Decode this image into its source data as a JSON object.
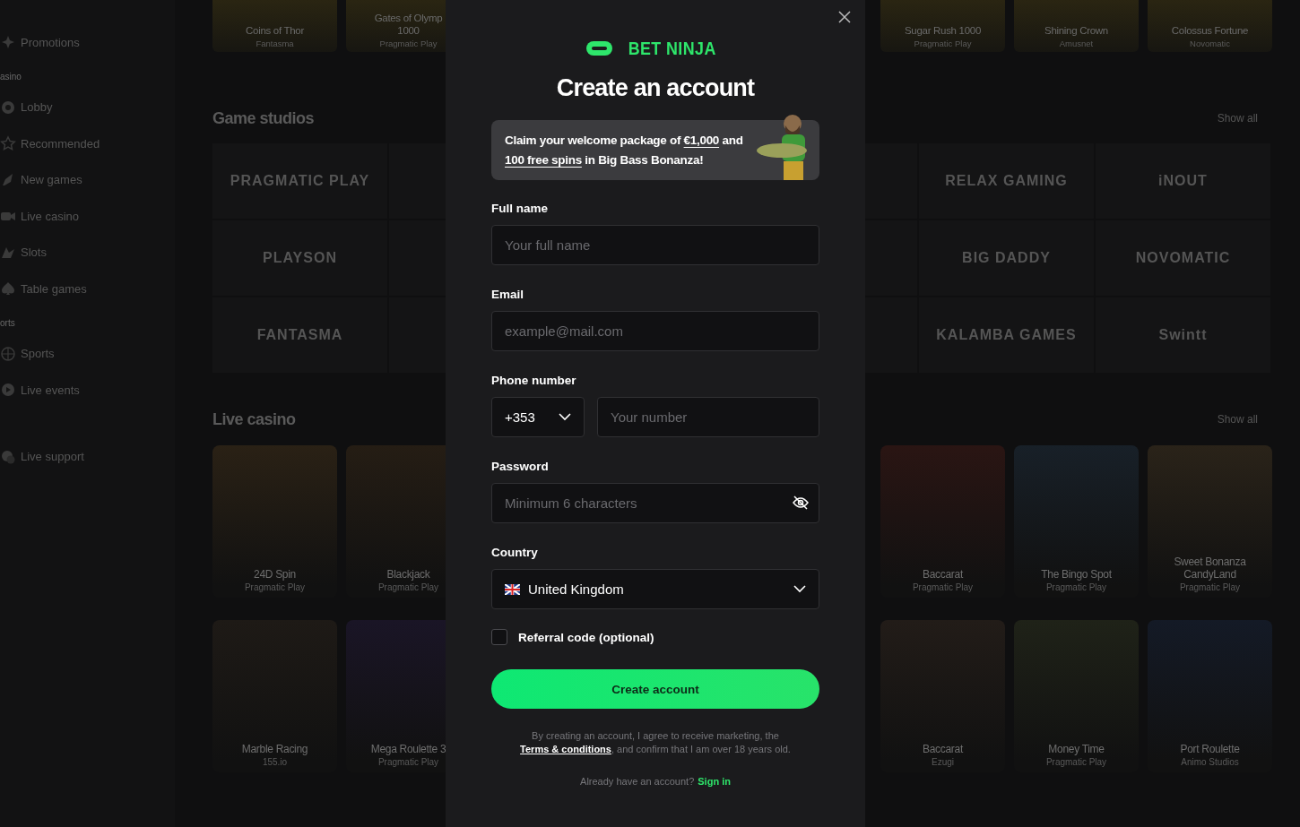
{
  "sidebar": {
    "items": [
      {
        "kind": "item",
        "label": "Promotions"
      },
      {
        "kind": "section",
        "label": "asino"
      },
      {
        "kind": "item",
        "label": "Lobby"
      },
      {
        "kind": "item",
        "label": "Recommended"
      },
      {
        "kind": "item",
        "label": "New games"
      },
      {
        "kind": "item",
        "label": "Live casino"
      },
      {
        "kind": "item",
        "label": "Slots"
      },
      {
        "kind": "item",
        "label": "Table games"
      },
      {
        "kind": "section",
        "label": "orts"
      },
      {
        "kind": "item",
        "label": "Sports"
      },
      {
        "kind": "item",
        "label": "Live events"
      },
      {
        "kind": "gap",
        "label": "Live support"
      }
    ]
  },
  "top_games": {
    "left": [
      {
        "title": "Coins of Thor",
        "provider": "Fantasma"
      },
      {
        "title": "Gates of Olymp\n1000",
        "provider": "Pragmatic Play"
      }
    ],
    "right": [
      {
        "title": "Sugar Rush 1000",
        "provider": "Pragmatic Play"
      },
      {
        "title": "Shining Crown",
        "provider": "Amusnet"
      },
      {
        "title": "Colossus Fortune",
        "provider": "Novomatic"
      }
    ]
  },
  "studios": {
    "title": "Game studios",
    "show_all": "Show all",
    "rows": [
      {
        "left": "PRAGMATIC PLAY",
        "right": [
          "RELAX GAMING",
          "iNOUT"
        ]
      },
      {
        "left": "PLAYSON",
        "right": [
          "BIG DADDY",
          "NOVOMATIC"
        ]
      },
      {
        "left": "FANTASMA",
        "right": [
          "KALAMBA GAMES",
          "Swintt"
        ]
      }
    ]
  },
  "live_casino": {
    "title": "Live casino",
    "show_all": "Show all",
    "rows": [
      {
        "left": [
          {
            "title": "24D Spin",
            "provider": "Pragmatic Play"
          },
          {
            "title": "Blackjack",
            "provider": "Pragmatic Play"
          }
        ],
        "right": [
          {
            "title": "Baccarat",
            "provider": "Pragmatic Play"
          },
          {
            "title": "The Bingo Spot",
            "provider": "Pragmatic Play"
          },
          {
            "title": "Sweet Bonanza CandyLand",
            "provider": "Pragmatic Play"
          }
        ]
      },
      {
        "left": [
          {
            "title": "Marble Racing",
            "provider": "155.io"
          },
          {
            "title": "Mega Roulette 3",
            "provider": "Pragmatic Play"
          }
        ],
        "right": [
          {
            "title": "Baccarat",
            "provider": "Ezugi"
          },
          {
            "title": "Money Time",
            "provider": "Pragmatic Play"
          },
          {
            "title": "Port Roulette",
            "provider": "Animo Studios"
          }
        ]
      }
    ]
  },
  "modal": {
    "brand": "BET NINJA",
    "title": "Create an account",
    "promo": [
      {
        "text": "Claim your welcome package of ",
        "kind": "text"
      },
      {
        "text": "€1,000",
        "kind": "link"
      },
      {
        "text": " and ",
        "kind": "text"
      },
      {
        "text": "100 free spins",
        "kind": "link"
      },
      {
        "text": " in Big Bass Bonanza!",
        "kind": "text"
      }
    ],
    "fields": [
      {
        "kind": "text",
        "label": "Full name",
        "placeholder": "Your full name"
      },
      {
        "kind": "text",
        "label": "Email",
        "placeholder": "example@mail.com"
      },
      {
        "kind": "phone",
        "label": "Phone number",
        "code": "+353",
        "placeholder": "Your number"
      },
      {
        "kind": "password",
        "label": "Password",
        "placeholder": "Minimum 6 characters"
      },
      {
        "kind": "country",
        "label": "Country",
        "value": "United Kingdom"
      }
    ],
    "referral": {
      "label": "Referral code (optional)",
      "checked": false
    },
    "submit": "Create account",
    "terms": [
      {
        "text": "By creating an account, I agree to receive marketing, the ",
        "kind": "text"
      },
      {
        "text": "Terms & conditions",
        "kind": "link"
      },
      {
        "text": ", and confirm that I am over 18 years old.",
        "kind": "text"
      }
    ],
    "signin": {
      "prompt": "Already have an account?",
      "link": "Sign in"
    }
  }
}
